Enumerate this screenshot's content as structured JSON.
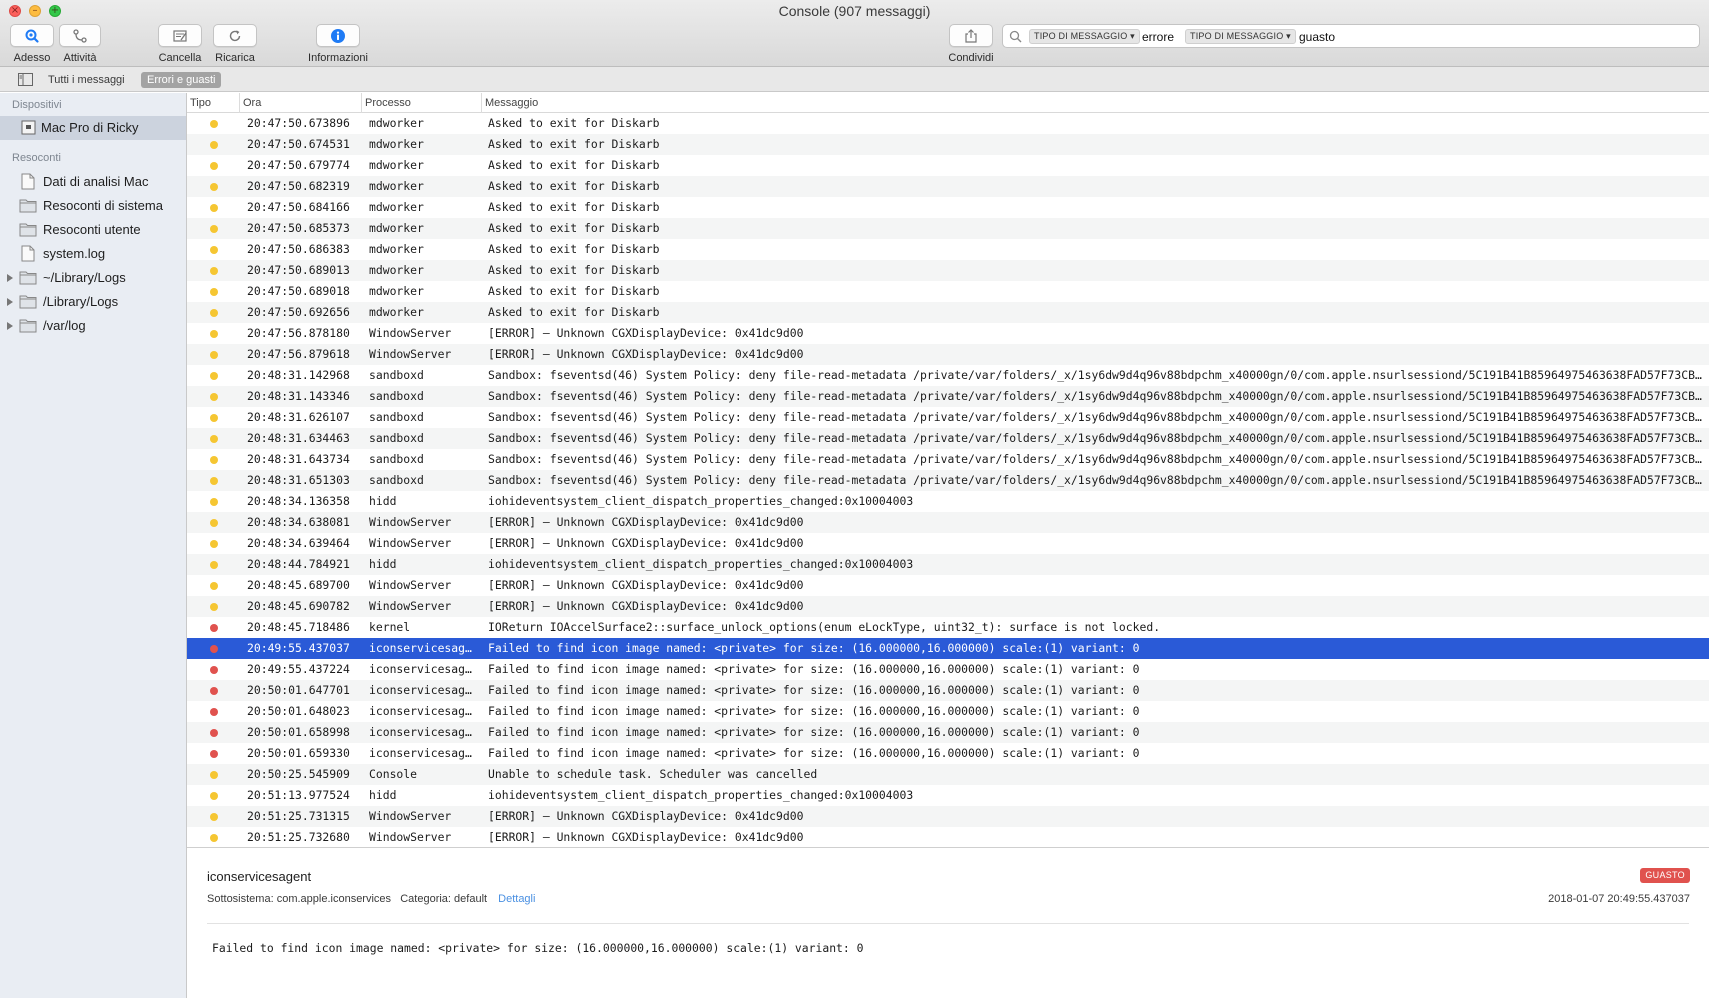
{
  "window": {
    "title": "Console (907 messaggi)"
  },
  "toolbar": {
    "now_label": "Adesso",
    "activity_label": "Attività",
    "clear_label": "Cancella",
    "reload_label": "Ricarica",
    "info_label": "Informazioni",
    "share_label": "Condividi"
  },
  "search": {
    "token1_type": "TIPO DI MESSAGGIO",
    "token1_value": "errore",
    "token2_type": "TIPO DI MESSAGGIO",
    "token2_value": "guasto"
  },
  "filters": {
    "all_label": "Tutti i messaggi",
    "errors_label": "Errori e guasti"
  },
  "sidebar": {
    "devices_header": "Dispositivi",
    "device": "Mac Pro di Ricky",
    "reports_header": "Resoconti",
    "reports": [
      {
        "label": "Dati di analisi Mac",
        "icon": "document-icon"
      },
      {
        "label": "Resoconti di sistema",
        "icon": "folder-icon"
      },
      {
        "label": "Resoconti utente",
        "icon": "folder-icon"
      },
      {
        "label": "system.log",
        "icon": "document-icon"
      },
      {
        "label": "~/Library/Logs",
        "icon": "folder-icon"
      },
      {
        "label": "/Library/Logs",
        "icon": "folder-icon"
      },
      {
        "label": "/var/log",
        "icon": "folder-icon"
      }
    ]
  },
  "table": {
    "columns": [
      "Tipo",
      "Ora",
      "Processo",
      "Messaggio"
    ],
    "rows": [
      {
        "type": "error",
        "time": "20:47:50.673896",
        "process": "mdworker",
        "message": "Asked to exit for Diskarb"
      },
      {
        "type": "error",
        "time": "20:47:50.674531",
        "process": "mdworker",
        "message": "Asked to exit for Diskarb"
      },
      {
        "type": "error",
        "time": "20:47:50.679774",
        "process": "mdworker",
        "message": "Asked to exit for Diskarb"
      },
      {
        "type": "error",
        "time": "20:47:50.682319",
        "process": "mdworker",
        "message": "Asked to exit for Diskarb"
      },
      {
        "type": "error",
        "time": "20:47:50.684166",
        "process": "mdworker",
        "message": "Asked to exit for Diskarb"
      },
      {
        "type": "error",
        "time": "20:47:50.685373",
        "process": "mdworker",
        "message": "Asked to exit for Diskarb"
      },
      {
        "type": "error",
        "time": "20:47:50.686383",
        "process": "mdworker",
        "message": "Asked to exit for Diskarb"
      },
      {
        "type": "error",
        "time": "20:47:50.689013",
        "process": "mdworker",
        "message": "Asked to exit for Diskarb"
      },
      {
        "type": "error",
        "time": "20:47:50.689018",
        "process": "mdworker",
        "message": "Asked to exit for Diskarb"
      },
      {
        "type": "error",
        "time": "20:47:50.692656",
        "process": "mdworker",
        "message": "Asked to exit for Diskarb"
      },
      {
        "type": "error",
        "time": "20:47:56.878180",
        "process": "WindowServer",
        "message": "[ERROR] – Unknown CGXDisplayDevice: 0x41dc9d00"
      },
      {
        "type": "error",
        "time": "20:47:56.879618",
        "process": "WindowServer",
        "message": "[ERROR] – Unknown CGXDisplayDevice: 0x41dc9d00"
      },
      {
        "type": "error",
        "time": "20:48:31.142968",
        "process": "sandboxd",
        "message": "Sandbox: fseventsd(46) System Policy: deny file-read-metadata /private/var/folders/_x/1sy6dw9d4q96v88bdpchm_x40000gn/0/com.apple.nsurlsessiond/5C191B41B85964975463638FAD57F73CB1…"
      },
      {
        "type": "error",
        "time": "20:48:31.143346",
        "process": "sandboxd",
        "message": "Sandbox: fseventsd(46) System Policy: deny file-read-metadata /private/var/folders/_x/1sy6dw9d4q96v88bdpchm_x40000gn/0/com.apple.nsurlsessiond/5C191B41B85964975463638FAD57F73CB1…"
      },
      {
        "type": "error",
        "time": "20:48:31.626107",
        "process": "sandboxd",
        "message": "Sandbox: fseventsd(46) System Policy: deny file-read-metadata /private/var/folders/_x/1sy6dw9d4q96v88bdpchm_x40000gn/0/com.apple.nsurlsessiond/5C191B41B85964975463638FAD57F73CB1…"
      },
      {
        "type": "error",
        "time": "20:48:31.634463",
        "process": "sandboxd",
        "message": "Sandbox: fseventsd(46) System Policy: deny file-read-metadata /private/var/folders/_x/1sy6dw9d4q96v88bdpchm_x40000gn/0/com.apple.nsurlsessiond/5C191B41B85964975463638FAD57F73CB1…"
      },
      {
        "type": "error",
        "time": "20:48:31.643734",
        "process": "sandboxd",
        "message": "Sandbox: fseventsd(46) System Policy: deny file-read-metadata /private/var/folders/_x/1sy6dw9d4q96v88bdpchm_x40000gn/0/com.apple.nsurlsessiond/5C191B41B85964975463638FAD57F73CB1…"
      },
      {
        "type": "error",
        "time": "20:48:31.651303",
        "process": "sandboxd",
        "message": "Sandbox: fseventsd(46) System Policy: deny file-read-metadata /private/var/folders/_x/1sy6dw9d4q96v88bdpchm_x40000gn/0/com.apple.nsurlsessiond/5C191B41B85964975463638FAD57F73CB1…"
      },
      {
        "type": "error",
        "time": "20:48:34.136358",
        "process": "hidd",
        "message": "iohideventsystem_client_dispatch_properties_changed:0x10004003"
      },
      {
        "type": "error",
        "time": "20:48:34.638081",
        "process": "WindowServer",
        "message": "[ERROR] – Unknown CGXDisplayDevice: 0x41dc9d00"
      },
      {
        "type": "error",
        "time": "20:48:34.639464",
        "process": "WindowServer",
        "message": "[ERROR] – Unknown CGXDisplayDevice: 0x41dc9d00"
      },
      {
        "type": "error",
        "time": "20:48:44.784921",
        "process": "hidd",
        "message": "iohideventsystem_client_dispatch_properties_changed:0x10004003"
      },
      {
        "type": "error",
        "time": "20:48:45.689700",
        "process": "WindowServer",
        "message": "[ERROR] – Unknown CGXDisplayDevice: 0x41dc9d00"
      },
      {
        "type": "error",
        "time": "20:48:45.690782",
        "process": "WindowServer",
        "message": "[ERROR] – Unknown CGXDisplayDevice: 0x41dc9d00"
      },
      {
        "type": "fault",
        "time": "20:48:45.718486",
        "process": "kernel",
        "message": "IOReturn IOAccelSurface2::surface_unlock_options(enum eLockType, uint32_t): surface is not locked."
      },
      {
        "type": "fault",
        "time": "20:49:55.437037",
        "process": "iconservicesag…",
        "message": "Failed to find icon image named: <private> for size: (16.000000,16.000000) scale:(1) variant: 0",
        "selected": true
      },
      {
        "type": "fault",
        "time": "20:49:55.437224",
        "process": "iconservicesag…",
        "message": "Failed to find icon image named: <private> for size: (16.000000,16.000000) scale:(1) variant: 0"
      },
      {
        "type": "fault",
        "time": "20:50:01.647701",
        "process": "iconservicesag…",
        "message": "Failed to find icon image named: <private> for size: (16.000000,16.000000) scale:(1) variant: 0"
      },
      {
        "type": "fault",
        "time": "20:50:01.648023",
        "process": "iconservicesag…",
        "message": "Failed to find icon image named: <private> for size: (16.000000,16.000000) scale:(1) variant: 0"
      },
      {
        "type": "fault",
        "time": "20:50:01.658998",
        "process": "iconservicesag…",
        "message": "Failed to find icon image named: <private> for size: (16.000000,16.000000) scale:(1) variant: 0"
      },
      {
        "type": "fault",
        "time": "20:50:01.659330",
        "process": "iconservicesag…",
        "message": "Failed to find icon image named: <private> for size: (16.000000,16.000000) scale:(1) variant: 0"
      },
      {
        "type": "error",
        "time": "20:50:25.545909",
        "process": "Console",
        "message": "Unable to schedule task. Scheduler was cancelled"
      },
      {
        "type": "error",
        "time": "20:51:13.977524",
        "process": "hidd",
        "message": "iohideventsystem_client_dispatch_properties_changed:0x10004003"
      },
      {
        "type": "error",
        "time": "20:51:25.731315",
        "process": "WindowServer",
        "message": "[ERROR] – Unknown CGXDisplayDevice: 0x41dc9d00"
      },
      {
        "type": "error",
        "time": "20:51:25.732680",
        "process": "WindowServer",
        "message": "[ERROR] – Unknown CGXDisplayDevice: 0x41dc9d00"
      }
    ]
  },
  "detail": {
    "process": "iconservicesagent",
    "subsystem_label": "Sottosistema:",
    "subsystem": "com.apple.iconservices",
    "category_label": "Categoria:",
    "category": "default",
    "details_link": "Dettagli",
    "badge": "GUASTO",
    "timestamp": "2018-01-07 20:49:55.437037",
    "message": "Failed to find icon image named: <private> for size: (16.000000,16.000000) scale:(1) variant: 0"
  },
  "colors": {
    "error_dot": "#f5c632",
    "fault_dot": "#e0524e",
    "selection": "#2a5ad7",
    "accent": "#1f7bf5"
  }
}
